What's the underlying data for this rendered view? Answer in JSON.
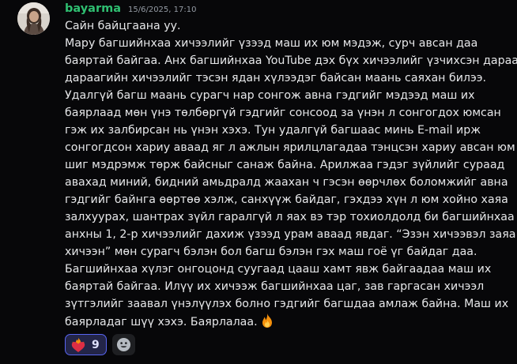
{
  "message": {
    "username": "bayarma",
    "timestamp": "15/6/2025, 17:10",
    "avatar_icon": "profile-photo",
    "lines": [
      "Сайн байцгаана уу.",
      "Мару багшийнхаа хичээлийг үзээд маш их юм мэдэж, сурч авсан даа",
      "баяртай байгаа. Анх багшийнхаа YouTube дэх бүх хичээлийг үзчихсэн  дараа",
      "дараагийн хичээлийг тэсэн ядан хүлээдэг байсан маань саяхан билээ.",
      "Удалгүй багш маань сурагч нар сонгож авна гэдгийг мэдээд маш их",
      "баярлаад мөн үнэ төлбөргүй гэдгийг сонсоод за үнэн л сонгогдох юмсан",
      "гэж их залбирсан нь үнэн хэхэ. Тун удалгүй багшаас минь E-mail ирж",
      "сонгогдсон хариу аваад яг л ажлын ярилцлагадаа тэнцсэн хариу авсан юм",
      "шиг мэдрэмж төрж байсныг санаж байна. Арилжаа гэдэг зүйлийг сураад",
      "аваxад миний, бидний амьдралд жаахан ч гэсэн өөрчлөх боломжийг авна",
      "гэдгийг байнга өөртөө хэлж, санхүүж байдаг, гэхдээ хүн л юм хойно хаяа",
      "залхуурах, шантрах зүйл гаралгүй л яах вэ тэр тохиолдолд би багшийнхаа",
      "анхны 1, 2-р хичээлийг дахиж үзээд урам аваад явдаг. “Эзэн хичээвэл заяа",
      "хичээн” мөн сурагч бэлэн бол багш бэлэн гэх маш гоё үг байдаг даа.",
      "Багшийнхаа хүлэг онгоцонд суугаад цааш хамт явж байгаадаа маш их",
      "баяртай байгаа. Илүү их хичээж багшийнхаа  цаг, зав гаргасан хичээл",
      "зүтгэлийг заавал үнэлүүлэх болно гэдгийг багшдаа амлаж байна.  Маш их",
      "баярладаг шүү хэхэ. Баярлалаа."
    ],
    "inline_emoji": "fire-emoji"
  },
  "reactions": [
    {
      "icon": "heart-on-fire-emoji",
      "count": "9",
      "accent": "#5865f2"
    }
  ],
  "add_reaction_icon": "add-reaction-smiley-icon",
  "colors": {
    "background": "#070709",
    "username": "#2fbf71",
    "timestamp": "#949ba4",
    "text": "#e6e7e9",
    "reaction_bg": "#232548",
    "reaction_border": "#5865f2"
  }
}
